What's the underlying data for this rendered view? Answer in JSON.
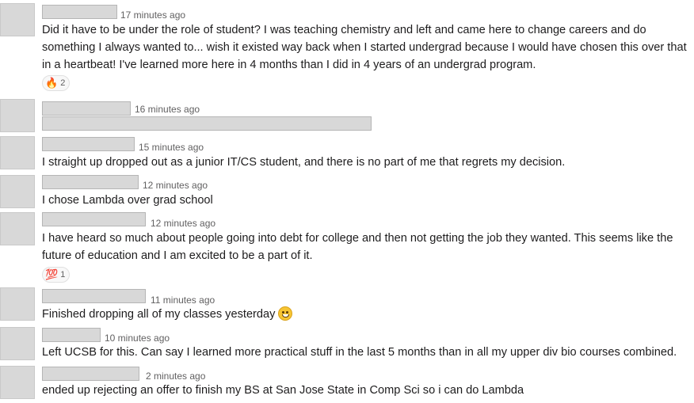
{
  "messages": [
    {
      "time": "17 minutes ago",
      "text": "Did it have to be under the role of student?  I was teaching chemistry and left and came here to change careers and do something I always wanted to...  wish it existed way back when I started undergrad because I would have chosen this over that in a heartbeat!  I've learned more here in 4 months than I did in 4 years of an undergrad program.",
      "reaction": {
        "emoji": "🔥",
        "count": "2"
      }
    },
    {
      "time": "16 minutes ago",
      "text": ""
    },
    {
      "time": "15 minutes ago",
      "text": "I straight up dropped out as a junior IT/CS student, and there is no part of me that regrets my decision."
    },
    {
      "time": "12 minutes ago",
      "text": "I chose Lambda over grad school"
    },
    {
      "time": "12 minutes ago",
      "text": "I have heard so much about people going into debt for college and then not getting the job they wanted. This seems like the future of education and I am excited to be a part of it.",
      "reaction": {
        "emoji": "💯",
        "count": "1"
      }
    },
    {
      "time": "11 minutes ago",
      "text": "Finished dropping all of my classes yesterday"
    },
    {
      "time": "10 minutes ago",
      "text": "Left UCSB for this.  Can say I learned more practical stuff in the last 5 months than in all my upper div bio courses combined."
    },
    {
      "time": "2 minutes ago",
      "text": "ended up rejecting an offer to finish my BS at San Jose State in Comp Sci so i can do Lambda"
    }
  ]
}
